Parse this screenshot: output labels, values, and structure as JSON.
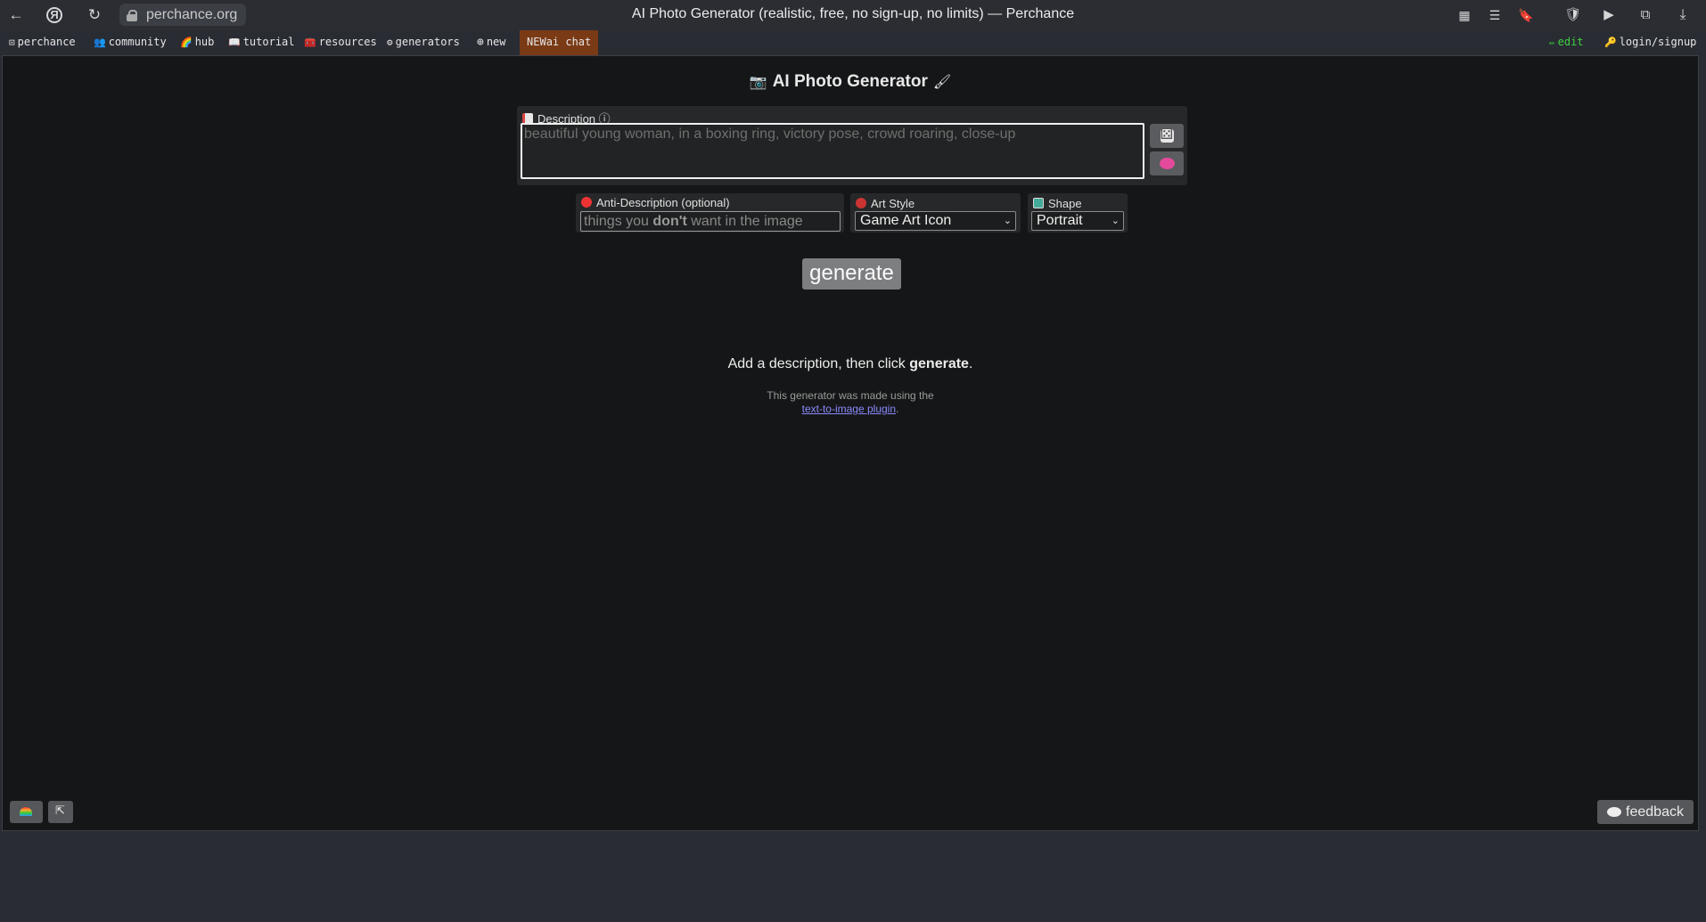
{
  "browser": {
    "url": "perchance.org",
    "title": "AI Photo Generator (realistic, free, no sign-up, no limits) — Perchance"
  },
  "nav": {
    "items": [
      {
        "label": "perchance"
      },
      {
        "label": "community"
      },
      {
        "label": "hub"
      },
      {
        "label": "tutorial"
      },
      {
        "label": "resources"
      },
      {
        "label": "generators"
      },
      {
        "label": "new"
      },
      {
        "label": "ai chat",
        "badge": "NEW"
      }
    ],
    "edit": "edit",
    "login": "login/signup"
  },
  "app": {
    "title": "AI Photo Generator",
    "title_icon_left": "camera-icon",
    "title_icon_right": "paintbrush-icon",
    "description": {
      "label": "Description",
      "info_icon": "ⓘ",
      "placeholder": "beautiful young woman, in a boxing ring, victory pose, crowd roaring, close-up"
    },
    "anti_description": {
      "label": "Anti-Description (optional)",
      "placeholder_before": "things you ",
      "placeholder_bold": "don't",
      "placeholder_after": " want in the image"
    },
    "art_style": {
      "label": "Art Style",
      "value": "Game Art Icon"
    },
    "shape": {
      "label": "Shape",
      "value": "Portrait"
    },
    "generate_label": "generate",
    "hint_before": "Add a description, then click ",
    "hint_bold": "generate",
    "hint_after": ".",
    "made_using_text": "This generator was made using the",
    "plugin_link": "text-to-image plugin",
    "plugin_after": ".",
    "feedback_label": "feedback"
  },
  "colors": {
    "accent_chat": "#7a3a15",
    "edit_green": "#3fd13f",
    "link": "#8b8bff"
  }
}
